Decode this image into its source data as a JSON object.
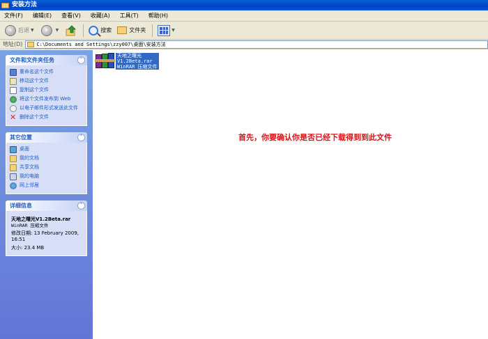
{
  "window": {
    "title": "安装方法"
  },
  "menu": [
    "文件(F)",
    "编辑(E)",
    "查看(V)",
    "收藏(A)",
    "工具(T)",
    "帮助(H)"
  ],
  "toolbar": {
    "back_label": "后退",
    "search_label": "搜索",
    "folders_label": "文件夹"
  },
  "address": {
    "label": "地址(D)",
    "path": "C:\\Documents and Settings\\zzy007\\桌面\\安装方法"
  },
  "sidebar": {
    "file_tasks": {
      "title": "文件和文件夹任务",
      "items": [
        "重命名这个文件",
        "移动这个文件",
        "复制这个文件",
        "将这个文件发布到 Web",
        "以电子邮件形式发送此文件",
        "删除这个文件"
      ]
    },
    "other_places": {
      "title": "其它位置",
      "items": [
        "桌面",
        "我的文档",
        "共享文档",
        "我的电脑",
        "网上邻居"
      ]
    },
    "details": {
      "title": "详细信息",
      "name": "天地之曙光V1.2Beta.rar",
      "type": "WinRAR 压缩文件",
      "modified": "修改日期: 13 February 2009, 16:51",
      "size": "大小: 23.4 MB"
    }
  },
  "file": {
    "line1": "天地之曙光",
    "line2": "V1.2Beta.rar",
    "line3": "WinRAR 压缩文件"
  },
  "note": "首先，你要确认你是否已经下载得到到此文件",
  "colors": {
    "titlebar": "#0a5fd8",
    "sidebar": "#7ba2e7",
    "link": "#215dc6",
    "note": "#d8131a",
    "selection": "#316ac5"
  }
}
